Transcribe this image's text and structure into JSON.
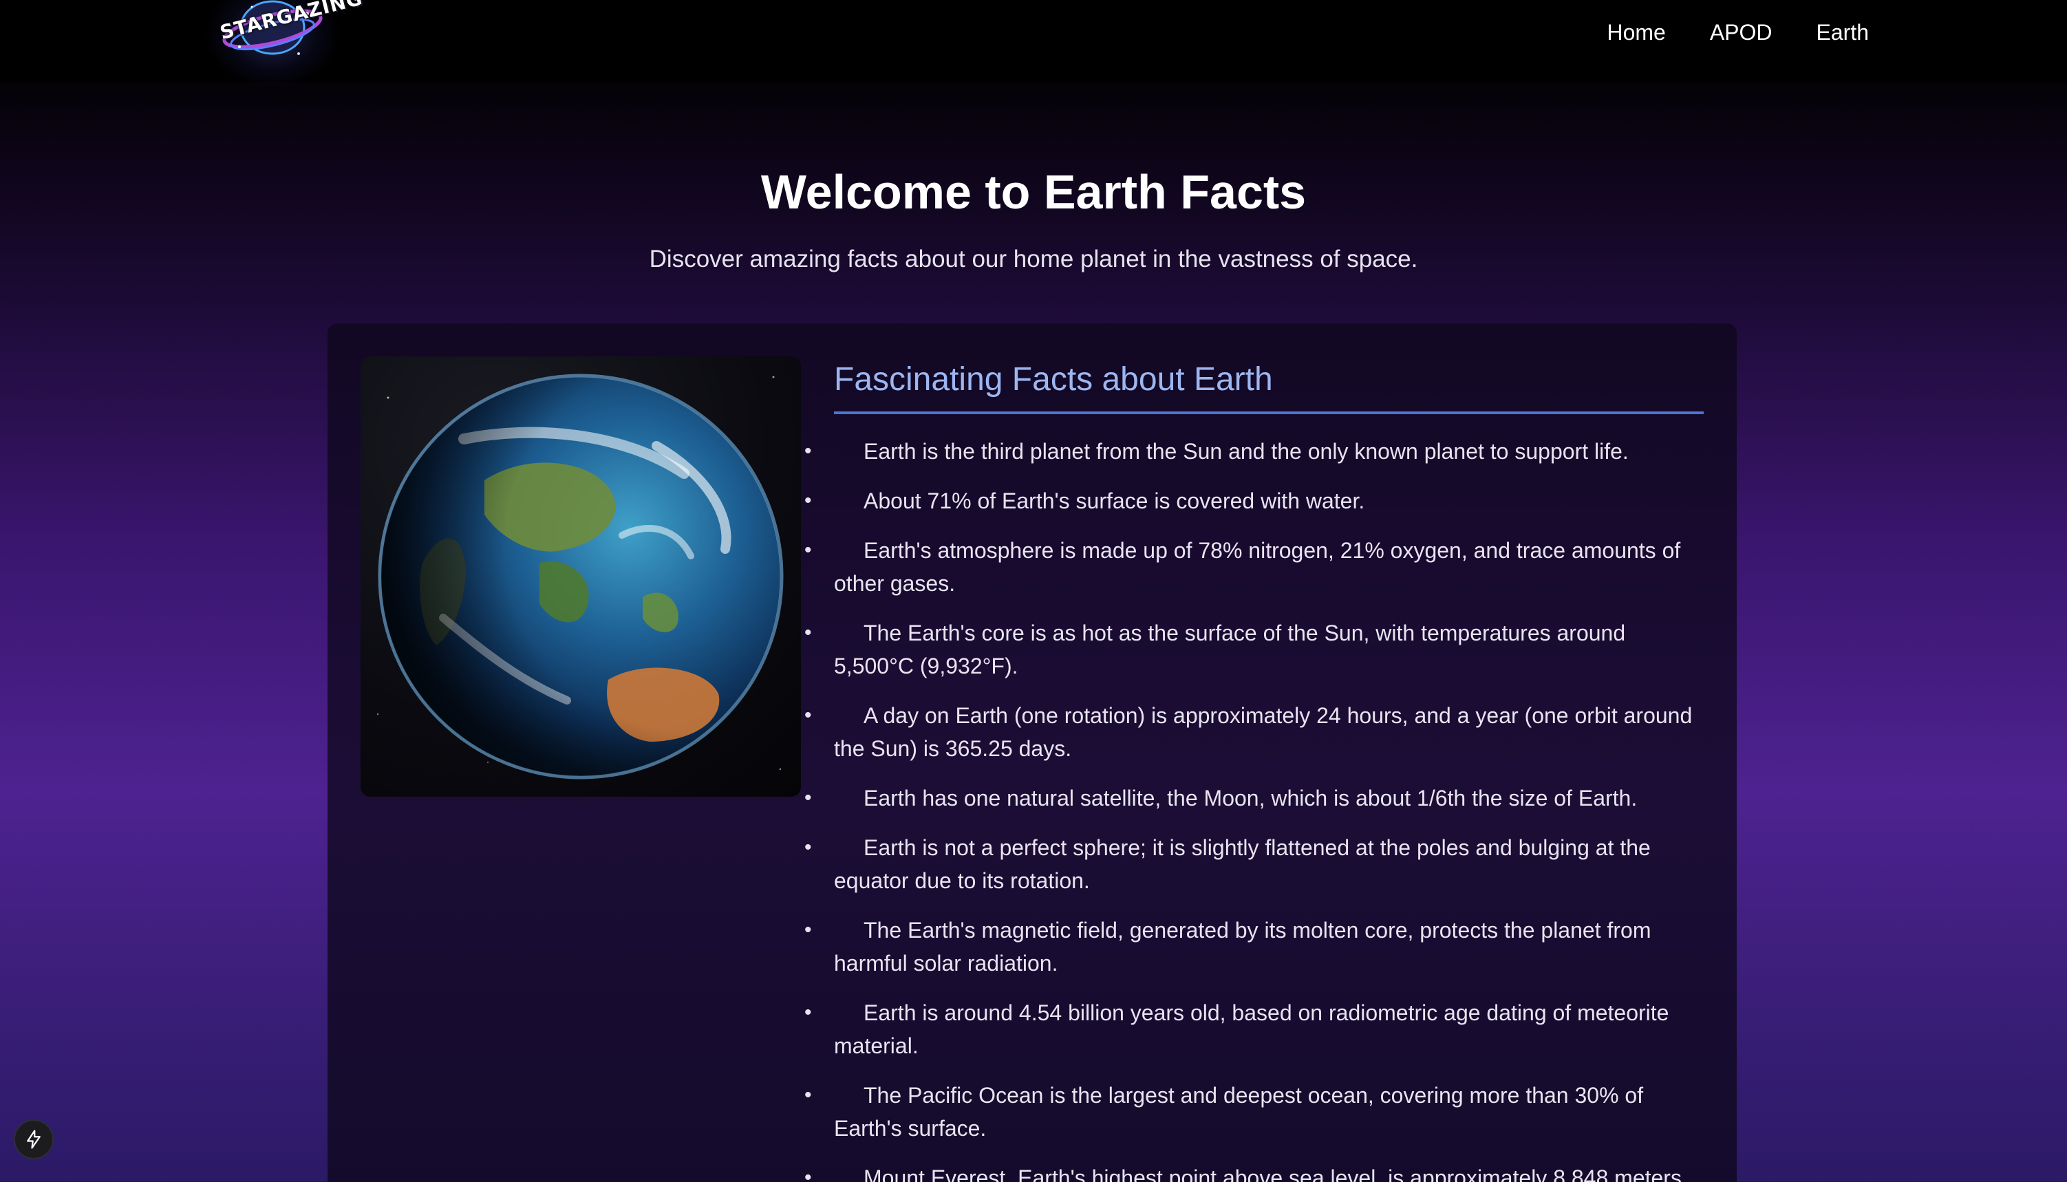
{
  "header": {
    "logo_text": "STARGAZING",
    "nav": [
      {
        "label": "Home"
      },
      {
        "label": "APOD"
      },
      {
        "label": "Earth"
      }
    ]
  },
  "hero": {
    "title": "Welcome to Earth Facts",
    "subtitle": "Discover amazing facts about our home planet in the vastness of space."
  },
  "facts": {
    "title": "Fascinating Facts about Earth",
    "items": [
      "Earth is the third planet from the Sun and the only known planet to support life.",
      "About 71% of Earth's surface is covered with water.",
      "Earth's atmosphere is made up of 78% nitrogen, 21% oxygen, and trace amounts of other gases.",
      "The Earth's core is as hot as the surface of the Sun, with temperatures around 5,500°C (9,932°F).",
      "A day on Earth (one rotation) is approximately 24 hours, and a year (one orbit around the Sun) is 365.25 days.",
      "Earth has one natural satellite, the Moon, which is about 1/6th the size of Earth.",
      "Earth is not a perfect sphere; it is slightly flattened at the poles and bulging at the equator due to its rotation.",
      "The Earth's magnetic field, generated by its molten core, protects the planet from harmful solar radiation.",
      "Earth is around 4.54 billion years old, based on radiometric age dating of meteorite material.",
      "The Pacific Ocean is the largest and deepest ocean, covering more than 30% of Earth's surface.",
      "Mount Everest, Earth's highest point above sea level, is approximately 8,848 meters"
    ]
  },
  "icons": {
    "logo": "stargazing-logo",
    "earth": "earth-image",
    "bolt": "lightning-bolt-icon"
  },
  "colors": {
    "accent": "#4d74d6",
    "facts_title": "#9db6f0"
  }
}
